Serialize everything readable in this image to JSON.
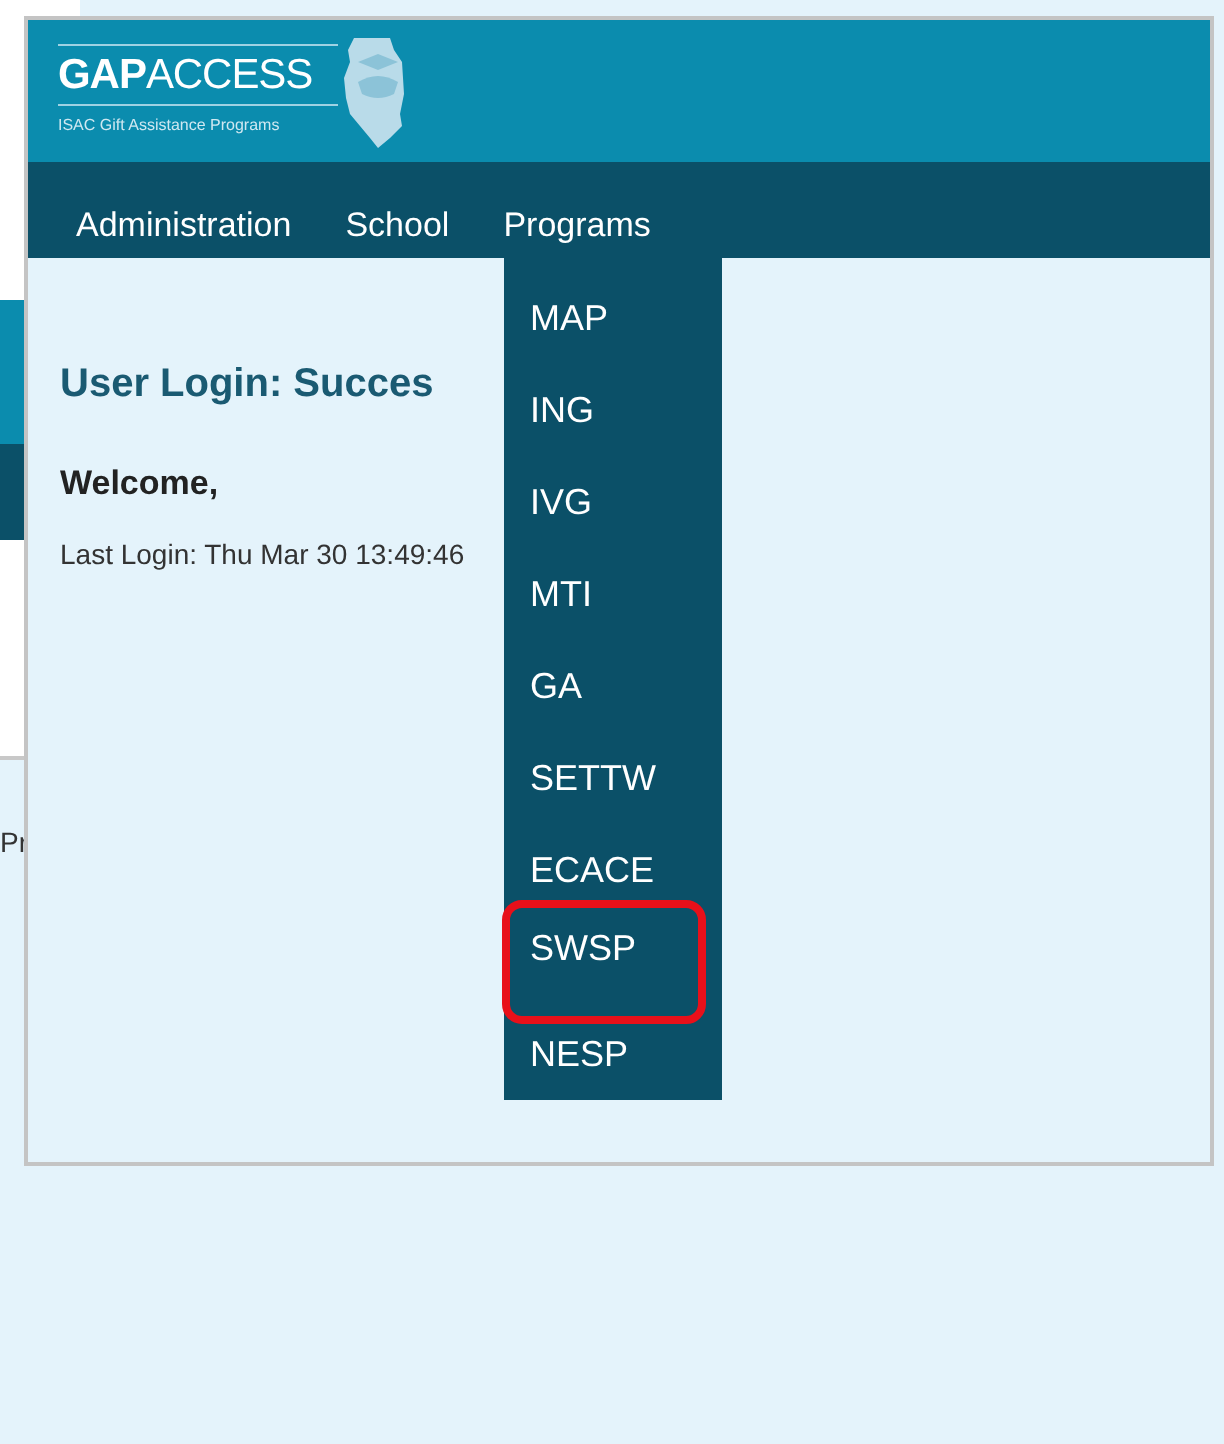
{
  "background_page": {
    "text": "Pr"
  },
  "window": {
    "logo": {
      "title": "**GAP**ACCESS",
      "subtitle": "ISAC Gift Assistance Programs"
    },
    "nav": [
      {
        "label": "Administration"
      },
      {
        "label": "School"
      },
      {
        "label": "Programs"
      }
    ],
    "heading": "User Login: Succes",
    "welcome": "Welcome,",
    "last_login": "Last Login: Thu Mar 30 13:49:46",
    "programs_menu": [
      {
        "label": "MAP",
        "highlighted": false
      },
      {
        "label": "ING",
        "highlighted": false
      },
      {
        "label": "IVG",
        "highlighted": false
      },
      {
        "label": "MTI",
        "highlighted": false
      },
      {
        "label": "GA",
        "highlighted": false
      },
      {
        "label": "SETTW",
        "highlighted": false
      },
      {
        "label": "ECACE",
        "highlighted": false
      },
      {
        "label": "SWSP",
        "highlighted": true
      },
      {
        "label": "NESP",
        "highlighted": false
      }
    ]
  }
}
